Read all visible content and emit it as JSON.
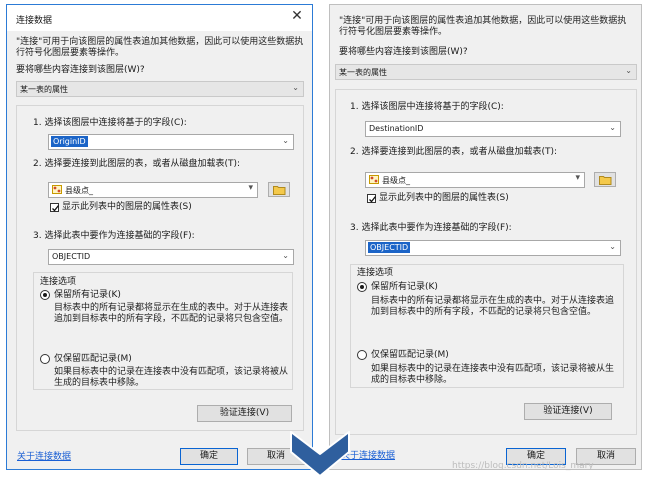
{
  "dialog": {
    "title": "连接数据",
    "intro": "\"连接\"可用于向该图层的属性表追加其他数据，因此可以使用这些数据执行符号化图层要素等操作。",
    "question": "要将哪些内容连接到该图层(W)?",
    "join_type": "某一表的属性",
    "step1": "1. 选择该图层中连接将基于的字段(C):",
    "step2": "2. 选择要连接到此图层的表，或者从磁盘加载表(T):",
    "table_value": "县级点_",
    "show_layers_label": "显示此列表中的图层的属性表(S)",
    "step3": "3. 选择此表中要作为连接基础的字段(F):",
    "options_title": "连接选项",
    "keep_all": "保留所有记录(K)",
    "keep_all_desc": "目标表中的所有记录都将显示在生成的表中。对于从连接表追加到目标表中的所有字段，不匹配的记录将只包含空值。",
    "keep_matching": "仅保留匹配记录(M)",
    "keep_matching_desc": "如果目标表中的记录在连接表中没有匹配项，该记录将被从生成的目标表中移除。",
    "validate": "验证连接(V)",
    "about": "关于连接数据",
    "ok": "确定",
    "cancel": "取消"
  },
  "left": {
    "field1": "OriginID",
    "field2": "OBJECTID"
  },
  "right": {
    "field1": "DestinationID",
    "field2": "OBJECTID"
  },
  "watermark": "https://blog.csdn.net/Lois_mary",
  "colors": {
    "accent": "#1b64c7",
    "arrow": "#2f5f9e",
    "link": "#1a5fd4"
  }
}
